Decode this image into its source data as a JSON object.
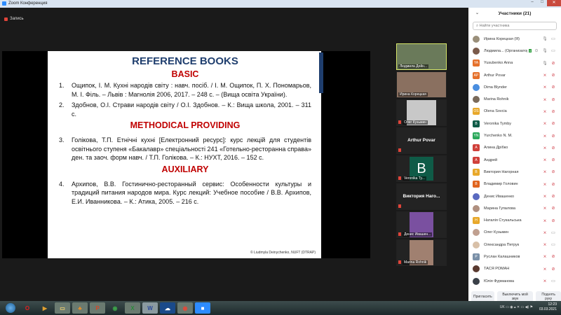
{
  "window": {
    "title": "Zoom Конференция",
    "recording": "Запись"
  },
  "slide": {
    "title": "REFERENCE BOOKS",
    "sections": [
      {
        "heading": "BASIC",
        "refs": [
          {
            "n": "1.",
            "text": "Ощипок, І. М.  Кухні народів світу : навч. посіб. / І. М. Ощипок, П. Х. Пономарьов, М. І. Філь. – Львів : Магнолія 2006, 2017. – 248 с. – (Вища освіта України)."
          },
          {
            "n": "2.",
            "text": "Здобнов, О.І. Страви народів світу / О.І. Здобнов. – К.: Вища школа, 2001. – 311 с."
          }
        ]
      },
      {
        "heading": "METHODICAL PROVIDING",
        "refs": [
          {
            "n": "3.",
            "text": "Голікова, Т.П. Етнічні кухні [Електронний ресурс]: курс лекцій для студентів освітнього ступеня «Бакалавр» спеціальності 241 «Готельно-ресторанна справа» ден. та заоч. форм навч. / Т.П. Голікова. – К.: НУХТ, 2016. – 152 с."
          }
        ]
      },
      {
        "heading": "AUXILIARY",
        "refs": [
          {
            "n": "4.",
            "text": "Архипов, В.В. Гостинично-ресторанный сервис: Особенности культуры и традиций питания народов мира. Курс лекций: Учебное пособие / В.В. Архипов, Е.И. Иванникова. – К.: Атика, 2005. – 216 с."
          }
        ]
      }
    ],
    "footer": "© Liudmyla Deinychenko, NUFT (DTRAP)"
  },
  "videos": [
    {
      "name": "Людмила Дейн..."
    },
    {
      "name": "Ирина Корецкая"
    },
    {
      "name": "Олег Кузьмин"
    },
    {
      "name": "Arthur Povar"
    },
    {
      "name": "Veronika Ty...",
      "initial": "B"
    },
    {
      "name": "Виктория  Наго..."
    },
    {
      "name": "Денис Ивашен..."
    },
    {
      "name": "Marina Rohnik"
    }
  ],
  "panel": {
    "title": "Участники (21)",
    "search_placeholder": "Найти участника",
    "participants": [
      {
        "name": "Ирина Корецкая (Я)",
        "initials": "",
        "color": "#9a8f7a",
        "mic": "on",
        "cam": "on"
      },
      {
        "name": "Людмила... (Организатор)",
        "initials": "",
        "color": "#7a5a4a",
        "mic": "on",
        "cam": "on",
        "badge": "4"
      },
      {
        "name": "Yusubenko Anna",
        "initials": "YA",
        "color": "#e5702a",
        "mic": "on",
        "cam": "off"
      },
      {
        "name": "Arthur Povar",
        "initials": "AP",
        "color": "#e5702a",
        "mic": "off",
        "cam": "off"
      },
      {
        "name": "Dima Blynder",
        "initials": "",
        "color": "#4a8ee0",
        "mic": "off",
        "cam": "off"
      },
      {
        "name": "Marina Rohnik",
        "initials": "",
        "color": "#7a6a5a",
        "mic": "off",
        "cam": "off"
      },
      {
        "name": "Olena Sovcia",
        "initials": "OS",
        "color": "#e8a82a",
        "mic": "off",
        "cam": "off"
      },
      {
        "name": "Veronika Tymby",
        "initials": "B",
        "color": "#0f5b47",
        "mic": "off",
        "cam": "off"
      },
      {
        "name": "Yurchenko N. M.",
        "initials": "YN",
        "color": "#2aa85a",
        "mic": "off",
        "cam": "off"
      },
      {
        "name": "Алина Дрібко",
        "initials": "A",
        "color": "#d0403a",
        "mic": "off",
        "cam": "off"
      },
      {
        "name": "Андрей",
        "initials": "A",
        "color": "#d0403a",
        "mic": "off",
        "cam": "off"
      },
      {
        "name": "Виктория Нагорная",
        "initials": "В",
        "color": "#e8a82a",
        "mic": "off",
        "cam": "off"
      },
      {
        "name": "Владимир Головин",
        "initials": "В",
        "color": "#e0641e",
        "mic": "off",
        "cam": "off"
      },
      {
        "name": "Денис Ивашенко",
        "initials": "",
        "color": "#5a6ac0",
        "mic": "off",
        "cam": "off"
      },
      {
        "name": "Марина Гупалова",
        "initials": "",
        "color": "#b09080",
        "mic": "off",
        "cam": "off"
      },
      {
        "name": "Наталія Стукальська",
        "initials": "Н",
        "color": "#e8a82a",
        "mic": "off",
        "cam": "off"
      },
      {
        "name": "Олег Кузьмин",
        "initials": "",
        "color": "#c0a090",
        "mic": "off",
        "cam": "on"
      },
      {
        "name": "Олександра Петрук",
        "initials": "",
        "color": "#d8c0a8",
        "mic": "off",
        "cam": "on"
      },
      {
        "name": "Руслан Калашников",
        "initials": "Р",
        "color": "#7a90a8",
        "mic": "off",
        "cam": "off"
      },
      {
        "name": "ТАСЯ РОМАН",
        "initials": "",
        "color": "#5a3a30",
        "mic": "off",
        "cam": "off"
      },
      {
        "name": "Юлія Фурманова",
        "initials": "",
        "color": "#3a4048",
        "mic": "off",
        "cam": "on"
      }
    ],
    "buttons": {
      "invite": "Пригласить",
      "mute": "Выключить мой звук",
      "raise": "Поднять руку"
    }
  },
  "taskbar": {
    "lang": "UK",
    "time": "12:23",
    "date": "03.03.2021"
  }
}
